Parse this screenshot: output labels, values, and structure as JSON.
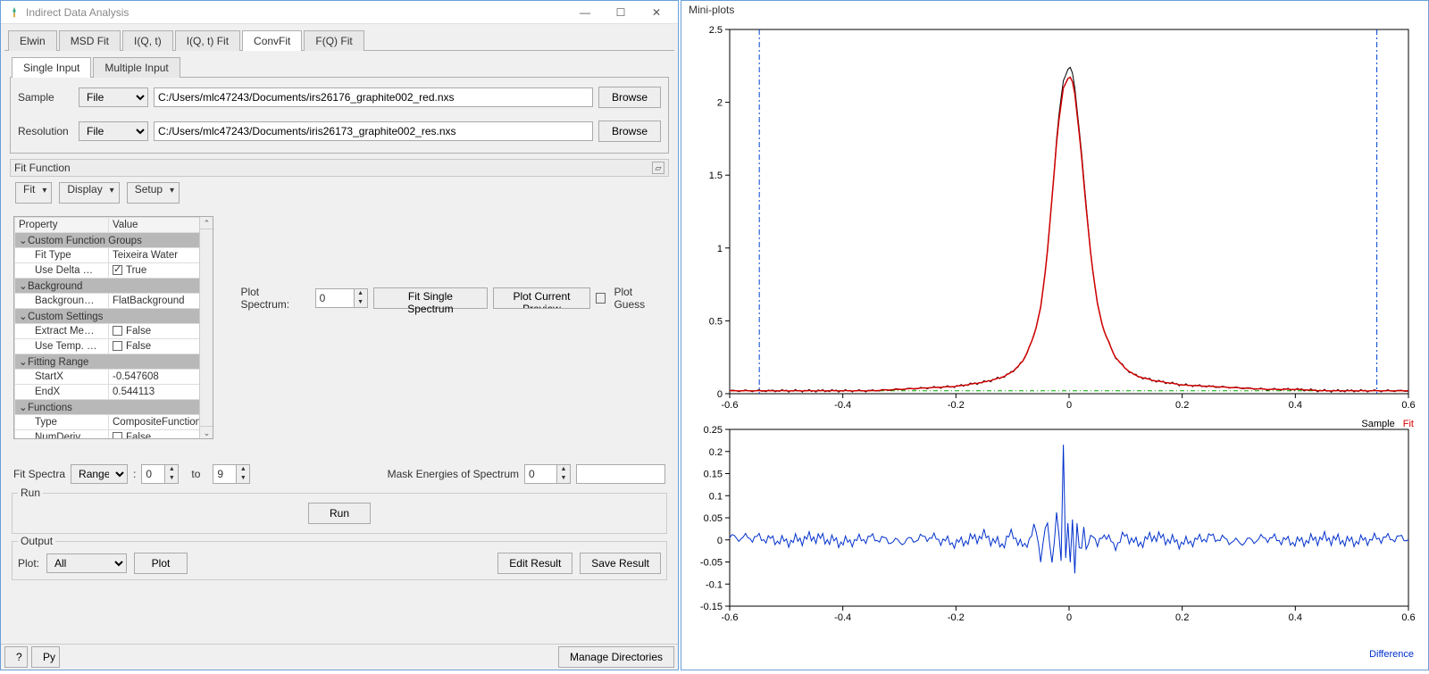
{
  "window": {
    "title": "Indirect Data Analysis",
    "tabs": [
      "Elwin",
      "MSD Fit",
      "I(Q, t)",
      "I(Q, t) Fit",
      "ConvFit",
      "F(Q) Fit"
    ],
    "active_tab": "ConvFit",
    "subtabs": [
      "Single Input",
      "Multiple Input"
    ],
    "active_subtab": "Single Input"
  },
  "inputs": {
    "sample_label": "Sample",
    "sample_mode": "File",
    "sample_path": "C:/Users/mlc47243/Documents/irs26176_graphite002_red.nxs",
    "resolution_label": "Resolution",
    "resolution_mode": "File",
    "resolution_path": "C:/Users/mlc47243/Documents/iris26173_graphite002_res.nxs",
    "browse": "Browse"
  },
  "fitfunc": {
    "title": "Fit Function",
    "buttons": {
      "fit": "Fit",
      "display": "Display",
      "setup": "Setup"
    },
    "headers": {
      "property": "Property",
      "value": "Value"
    },
    "groups": {
      "custom_function_groups": "Custom Function Groups",
      "fit_type_label": "Fit Type",
      "fit_type_value": "Teixeira Water",
      "use_delta_label": "Use Delta …",
      "use_delta_value": "True",
      "background_group": "Background",
      "background_label": "Backgroun…",
      "background_value": "FlatBackground",
      "custom_settings": "Custom Settings",
      "extract_me_label": "Extract Me…",
      "extract_me_value": "False",
      "use_temp_label": "Use Temp. …",
      "use_temp_value": "False",
      "fitting_range": "Fitting Range",
      "startx_label": "StartX",
      "startx_value": "-0.547608",
      "endx_label": "EndX",
      "endx_value": "0.544113",
      "functions": "Functions",
      "type_label": "Type",
      "type_value": "CompositeFunction",
      "numderiv_label": "NumDeriv",
      "numderiv_value": "False"
    }
  },
  "spectrum": {
    "label": "Plot Spectrum:",
    "value": "0",
    "fit_single": "Fit Single Spectrum",
    "plot_preview": "Plot Current Preview",
    "plot_guess": "Plot Guess"
  },
  "fitspectra": {
    "label": "Fit Spectra",
    "mode": "Range",
    "from": "0",
    "to_label": "to",
    "to": "9",
    "mask_label": "Mask Energies of Spectrum",
    "mask_spec": "0"
  },
  "run": {
    "title": "Run",
    "button": "Run"
  },
  "output": {
    "title": "Output",
    "plot_label": "Plot:",
    "plot_mode": "All",
    "plot_btn": "Plot",
    "edit_result": "Edit Result",
    "save_result": "Save Result"
  },
  "bottom": {
    "help": "?",
    "py": "Py",
    "manage": "Manage Directories"
  },
  "miniplots": {
    "title": "Mini-plots",
    "legend_top": {
      "sample": "Sample",
      "fit": "Fit"
    },
    "legend_bottom": {
      "difference": "Difference"
    }
  },
  "chart_data": [
    {
      "type": "line",
      "title": "",
      "xlabel": "",
      "ylabel": "",
      "xlim": [
        -0.6,
        0.6
      ],
      "ylim": [
        0,
        2.5
      ],
      "xticks": [
        -0.6,
        -0.4,
        -0.2,
        0,
        0.2,
        0.4,
        0.6
      ],
      "yticks": [
        0,
        0.5,
        1,
        1.5,
        2,
        2.5
      ],
      "vlines": [
        -0.547608,
        0.544113
      ],
      "series": [
        {
          "name": "Sample",
          "color": "#000000",
          "x": [
            -0.55,
            -0.5,
            -0.45,
            -0.4,
            -0.35,
            -0.3,
            -0.25,
            -0.2,
            -0.15,
            -0.12,
            -0.1,
            -0.08,
            -0.06,
            -0.05,
            -0.04,
            -0.03,
            -0.02,
            -0.01,
            0,
            0.005,
            0.01,
            0.02,
            0.03,
            0.04,
            0.05,
            0.06,
            0.08,
            0.1,
            0.12,
            0.15,
            0.2,
            0.25,
            0.3,
            0.35,
            0.4,
            0.45,
            0.5,
            0.55
          ],
          "y": [
            0.02,
            0.02,
            0.02,
            0.02,
            0.02,
            0.03,
            0.04,
            0.05,
            0.08,
            0.11,
            0.15,
            0.23,
            0.42,
            0.6,
            0.9,
            1.35,
            1.85,
            2.15,
            2.25,
            2.22,
            2.1,
            1.75,
            1.3,
            0.9,
            0.62,
            0.45,
            0.26,
            0.17,
            0.12,
            0.09,
            0.06,
            0.05,
            0.04,
            0.03,
            0.03,
            0.02,
            0.02,
            0.02
          ]
        },
        {
          "name": "Fit",
          "color": "#d00000",
          "x": [
            -0.55,
            -0.5,
            -0.45,
            -0.4,
            -0.35,
            -0.3,
            -0.25,
            -0.2,
            -0.15,
            -0.12,
            -0.1,
            -0.08,
            -0.06,
            -0.05,
            -0.04,
            -0.03,
            -0.02,
            -0.01,
            0,
            0.005,
            0.01,
            0.02,
            0.03,
            0.04,
            0.05,
            0.06,
            0.08,
            0.1,
            0.12,
            0.15,
            0.2,
            0.25,
            0.3,
            0.35,
            0.4,
            0.45,
            0.5,
            0.55
          ],
          "y": [
            0.02,
            0.02,
            0.02,
            0.02,
            0.02,
            0.03,
            0.04,
            0.05,
            0.08,
            0.11,
            0.15,
            0.23,
            0.42,
            0.6,
            0.9,
            1.35,
            1.82,
            2.1,
            2.18,
            2.16,
            2.06,
            1.72,
            1.28,
            0.9,
            0.62,
            0.45,
            0.26,
            0.17,
            0.12,
            0.09,
            0.06,
            0.05,
            0.04,
            0.03,
            0.03,
            0.02,
            0.02,
            0.02
          ]
        }
      ]
    },
    {
      "type": "line",
      "title": "",
      "xlabel": "",
      "ylabel": "",
      "xlim": [
        -0.6,
        0.6
      ],
      "ylim": [
        -0.15,
        0.25
      ],
      "xticks": [
        -0.6,
        -0.4,
        -0.2,
        0,
        0.2,
        0.4,
        0.6
      ],
      "yticks": [
        -0.15,
        -0.1,
        -0.05,
        0,
        0.05,
        0.1,
        0.15,
        0.2,
        0.25
      ],
      "series": [
        {
          "name": "Difference",
          "color": "#0030cc",
          "x": [
            -0.55,
            -0.5,
            -0.45,
            -0.4,
            -0.35,
            -0.3,
            -0.25,
            -0.2,
            -0.15,
            -0.12,
            -0.1,
            -0.08,
            -0.06,
            -0.05,
            -0.04,
            -0.03,
            -0.02,
            -0.015,
            -0.01,
            -0.005,
            0,
            0.003,
            0.007,
            0.01,
            0.015,
            0.02,
            0.025,
            0.03,
            0.04,
            0.05,
            0.06,
            0.08,
            0.1,
            0.12,
            0.15,
            0.2,
            0.25,
            0.3,
            0.35,
            0.4,
            0.45,
            0.5,
            0.55
          ],
          "y": [
            0.005,
            -0.004,
            0.006,
            -0.006,
            0.005,
            -0.005,
            0.007,
            -0.008,
            0.01,
            -0.012,
            0.015,
            -0.02,
            0.03,
            -0.04,
            0.045,
            -0.05,
            0.09,
            -0.12,
            0.22,
            -0.1,
            0.14,
            -0.15,
            0.1,
            -0.08,
            0.07,
            -0.06,
            0.04,
            -0.03,
            0.025,
            -0.02,
            0.018,
            -0.015,
            0.012,
            -0.01,
            0.009,
            -0.008,
            0.007,
            -0.006,
            0.005,
            -0.005,
            0.004,
            -0.004,
            0.004
          ]
        }
      ]
    }
  ]
}
